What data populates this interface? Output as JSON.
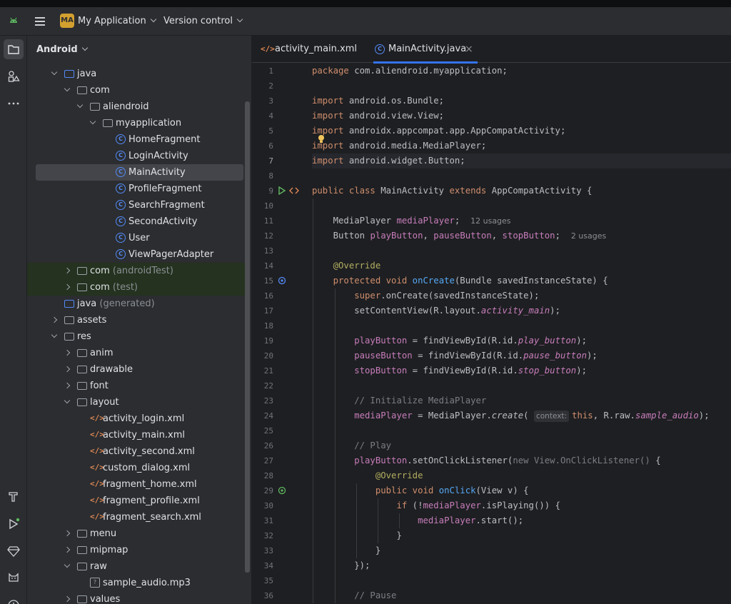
{
  "toolbar": {
    "project_badge": "MA",
    "project_name": "My Application",
    "vcs_label": "Version control"
  },
  "project_panel": {
    "title": "Android",
    "tree": [
      {
        "label": "java",
        "suffix": "",
        "depth": 1,
        "arrow": "open",
        "icon": "folder-blue"
      },
      {
        "label": "com",
        "suffix": "",
        "depth": 2,
        "arrow": "open",
        "icon": "package"
      },
      {
        "label": "aliendroid",
        "suffix": "",
        "depth": 3,
        "arrow": "open",
        "icon": "package"
      },
      {
        "label": "myapplication",
        "suffix": "",
        "depth": 4,
        "arrow": "open",
        "icon": "package"
      },
      {
        "label": "HomeFragment",
        "suffix": "",
        "depth": 5,
        "arrow": "",
        "icon": "class"
      },
      {
        "label": "LoginActivity",
        "suffix": "",
        "depth": 5,
        "arrow": "",
        "icon": "class"
      },
      {
        "label": "MainActivity",
        "suffix": "",
        "depth": 5,
        "arrow": "",
        "icon": "class",
        "selected": true
      },
      {
        "label": "ProfileFragment",
        "suffix": "",
        "depth": 5,
        "arrow": "",
        "icon": "class"
      },
      {
        "label": "SearchFragment",
        "suffix": "",
        "depth": 5,
        "arrow": "",
        "icon": "class"
      },
      {
        "label": "SecondActivity",
        "suffix": "",
        "depth": 5,
        "arrow": "",
        "icon": "class"
      },
      {
        "label": "User",
        "suffix": "",
        "depth": 5,
        "arrow": "",
        "icon": "class"
      },
      {
        "label": "ViewPagerAdapter",
        "suffix": "",
        "depth": 5,
        "arrow": "",
        "icon": "class"
      },
      {
        "label": "com",
        "suffix": " (androidTest)",
        "depth": 2,
        "arrow": "closed",
        "icon": "package",
        "tested": true
      },
      {
        "label": "com",
        "suffix": " (test)",
        "depth": 2,
        "arrow": "closed",
        "icon": "package",
        "tested": true
      },
      {
        "label": "java",
        "suffix": " (generated)",
        "depth": 1,
        "arrow": "",
        "icon": "folder-blue"
      },
      {
        "label": "assets",
        "suffix": "",
        "depth": 1,
        "arrow": "closed",
        "icon": "folder"
      },
      {
        "label": "res",
        "suffix": "",
        "depth": 1,
        "arrow": "open",
        "icon": "folder"
      },
      {
        "label": "anim",
        "suffix": "",
        "depth": 2,
        "arrow": "closed",
        "icon": "package"
      },
      {
        "label": "drawable",
        "suffix": "",
        "depth": 2,
        "arrow": "closed",
        "icon": "package"
      },
      {
        "label": "font",
        "suffix": "",
        "depth": 2,
        "arrow": "closed",
        "icon": "package"
      },
      {
        "label": "layout",
        "suffix": "",
        "depth": 2,
        "arrow": "open",
        "icon": "package"
      },
      {
        "label": "activity_login.xml",
        "suffix": "",
        "depth": 3,
        "arrow": "",
        "icon": "xml"
      },
      {
        "label": "activity_main.xml",
        "suffix": "",
        "depth": 3,
        "arrow": "",
        "icon": "xml"
      },
      {
        "label": "activity_second.xml",
        "suffix": "",
        "depth": 3,
        "arrow": "",
        "icon": "xml"
      },
      {
        "label": "custom_dialog.xml",
        "suffix": "",
        "depth": 3,
        "arrow": "",
        "icon": "xml"
      },
      {
        "label": "fragment_home.xml",
        "suffix": "",
        "depth": 3,
        "arrow": "",
        "icon": "xml"
      },
      {
        "label": "fragment_profile.xml",
        "suffix": "",
        "depth": 3,
        "arrow": "",
        "icon": "xml"
      },
      {
        "label": "fragment_search.xml",
        "suffix": "",
        "depth": 3,
        "arrow": "",
        "icon": "xml"
      },
      {
        "label": "menu",
        "suffix": "",
        "depth": 2,
        "arrow": "closed",
        "icon": "package"
      },
      {
        "label": "mipmap",
        "suffix": "",
        "depth": 2,
        "arrow": "closed",
        "icon": "package"
      },
      {
        "label": "raw",
        "suffix": "",
        "depth": 2,
        "arrow": "open",
        "icon": "package"
      },
      {
        "label": "sample_audio.mp3",
        "suffix": "",
        "depth": 3,
        "arrow": "",
        "icon": "file"
      },
      {
        "label": "values",
        "suffix": "",
        "depth": 2,
        "arrow": "closed",
        "icon": "package"
      }
    ]
  },
  "editor": {
    "tabs": [
      {
        "label": "activity_main.xml",
        "icon": "xml",
        "active": false
      },
      {
        "label": "MainActivity.java",
        "icon": "class",
        "active": true,
        "close": "×"
      }
    ],
    "current_line": 7,
    "lines": [
      [
        [
          "kw",
          "package "
        ],
        [
          "",
          "com.aliendroid.myapplication;"
        ]
      ],
      [],
      [
        [
          "kw",
          "import "
        ],
        [
          "",
          "android.os.Bundle;"
        ]
      ],
      [
        [
          "kw",
          "import "
        ],
        [
          "",
          "android.view.View;"
        ]
      ],
      [
        [
          "kw",
          "import "
        ],
        [
          "",
          "androidx.appcompat.app.AppCompatActivity;"
        ]
      ],
      [
        [
          "kw",
          "import "
        ],
        [
          "",
          "android.media.MediaPlayer;"
        ]
      ],
      [
        [
          "kw",
          "import "
        ],
        [
          "",
          "android.widget.Button;"
        ]
      ],
      [],
      [
        [
          "kw",
          "public class "
        ],
        [
          "",
          "MainActivity "
        ],
        [
          "kw",
          "extends "
        ],
        [
          "",
          "AppCompatActivity {"
        ]
      ],
      [],
      [
        [
          "",
          "    MediaPlayer "
        ],
        [
          "fld",
          "mediaPlayer"
        ],
        [
          "",
          ";  "
        ],
        [
          "hint",
          "12 usages"
        ]
      ],
      [
        [
          "",
          "    Button "
        ],
        [
          "fld",
          "playButton"
        ],
        [
          "",
          ", "
        ],
        [
          "fld",
          "pauseButton"
        ],
        [
          "",
          ", "
        ],
        [
          "fld",
          "stopButton"
        ],
        [
          "",
          ";  "
        ],
        [
          "hint",
          "2 usages"
        ]
      ],
      [],
      [
        [
          "ann",
          "    @Override"
        ]
      ],
      [
        [
          "kw",
          "    protected void "
        ],
        [
          "fn",
          "onCreate"
        ],
        [
          "",
          "(Bundle savedInstanceState) {"
        ]
      ],
      [
        [
          "kw",
          "        super"
        ],
        [
          "",
          ".onCreate(savedInstanceState);"
        ]
      ],
      [
        [
          "",
          "        setContentView(R.layout."
        ],
        [
          "it",
          "activity_main"
        ],
        [
          "",
          ");"
        ]
      ],
      [],
      [
        [
          "fld",
          "        playButton"
        ],
        [
          "",
          " = findViewById(R.id."
        ],
        [
          "it",
          "play_button"
        ],
        [
          "",
          ");"
        ]
      ],
      [
        [
          "fld",
          "        pauseButton"
        ],
        [
          "",
          " = findViewById(R.id."
        ],
        [
          "it",
          "pause_button"
        ],
        [
          "",
          ");"
        ]
      ],
      [
        [
          "fld",
          "        stopButton"
        ],
        [
          "",
          " = findViewById(R.id."
        ],
        [
          "it",
          "stop_button"
        ],
        [
          "",
          ");"
        ]
      ],
      [],
      [
        [
          "cm",
          "        // Initialize MediaPlayer"
        ]
      ],
      [
        [
          "fld",
          "        mediaPlayer"
        ],
        [
          "",
          " = MediaPlayer."
        ],
        [
          "itfn",
          "create"
        ],
        [
          "",
          "( "
        ],
        [
          "inlay",
          "context:"
        ],
        [
          "kw",
          "this"
        ],
        [
          "",
          ", R.raw."
        ],
        [
          "it",
          "sample_audio"
        ],
        [
          "",
          ");"
        ]
      ],
      [],
      [
        [
          "cm",
          "        // Play"
        ]
      ],
      [
        [
          "fld",
          "        playButton"
        ],
        [
          "",
          ".setOnClickListener("
        ],
        [
          "cm",
          "new View.OnClickListener() "
        ],
        [
          "",
          "{"
        ]
      ],
      [
        [
          "ann",
          "            @Override"
        ]
      ],
      [
        [
          "kw",
          "            public void "
        ],
        [
          "fn",
          "onClick"
        ],
        [
          "",
          "(View v) {"
        ]
      ],
      [
        [
          "kw",
          "                if "
        ],
        [
          "",
          "(!"
        ],
        [
          "fld",
          "mediaPlayer"
        ],
        [
          "",
          ".isPlaying()) {"
        ]
      ],
      [
        [
          "fld",
          "                    mediaPlayer"
        ],
        [
          "",
          ".start();"
        ]
      ],
      [
        [
          "",
          "                }"
        ]
      ],
      [
        [
          "",
          "            }"
        ]
      ],
      [
        [
          "",
          "        });"
        ]
      ],
      [],
      [
        [
          "cm",
          "        // Pause"
        ]
      ]
    ]
  }
}
